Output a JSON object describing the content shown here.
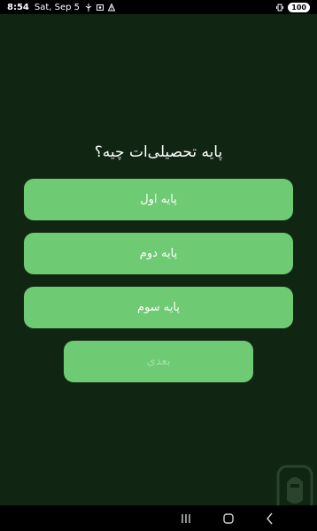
{
  "status_bar": {
    "time": "8:54",
    "date": "Sat, Sep 5",
    "battery": "100",
    "icons_left": [
      "usb-icon",
      "screenshot-icon",
      "signal-off-icon"
    ],
    "icons_right": [
      "vibrate-icon",
      "battery-icon"
    ]
  },
  "question": {
    "title": "پایه تحصیلی‌ات چیه؟"
  },
  "options": [
    {
      "label": "پایه اول"
    },
    {
      "label": "پایه دوم"
    },
    {
      "label": "پایه سوم"
    }
  ],
  "next_button": {
    "label": "بعدی",
    "enabled": false
  },
  "colors": {
    "background": "#112612",
    "button": "#6ecb73",
    "button_text": "#ffffff",
    "disabled_text": "#a7dca9"
  },
  "nav_bar": {
    "icons": [
      "recents-icon",
      "home-icon",
      "back-icon"
    ]
  }
}
